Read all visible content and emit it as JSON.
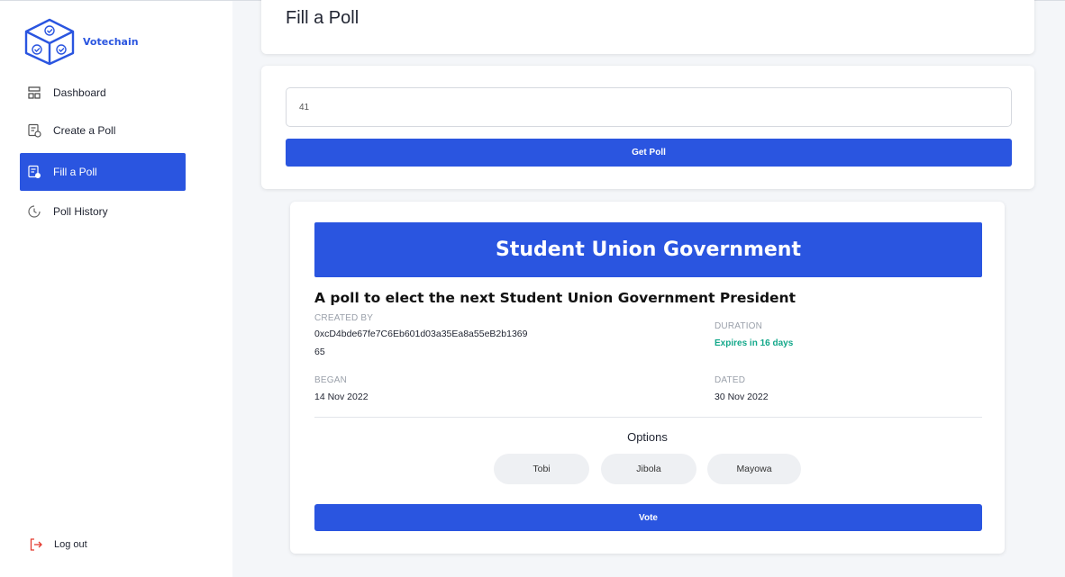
{
  "brand": {
    "name": "Votechain",
    "accent": "#2a55e0"
  },
  "sidebar": {
    "items": [
      {
        "label": "Dashboard",
        "icon": "dashboard-icon",
        "active": false
      },
      {
        "label": "Create a Poll",
        "icon": "create-poll-icon",
        "active": false
      },
      {
        "label": "Fill a Poll",
        "icon": "fill-poll-icon",
        "active": true
      },
      {
        "label": "Poll History",
        "icon": "clock-icon",
        "active": false
      }
    ],
    "logout_label": "Log out"
  },
  "page": {
    "title": "Fill a Poll"
  },
  "search": {
    "value": "41",
    "button_label": "Get Poll"
  },
  "poll": {
    "title": "Student Union Government",
    "description": "A poll to elect the next Student Union Government President",
    "created_by_label": "CREATED BY",
    "created_by_line1": "0xcD4bde67fe7C6Eb601d03a35Ea8a55eB2b1369",
    "created_by_line2": "65",
    "duration_label": "DURATION",
    "duration_value": "Expires in 16 days",
    "began_label": "BEGAN",
    "began_value": "14 Nov 2022",
    "dated_label": "DATED",
    "dated_value": "30 Nov 2022",
    "options_title": "Options",
    "options": [
      "Tobi",
      "Jibola",
      "Mayowa"
    ],
    "vote_label": "Vote"
  },
  "colors": {
    "accent": "#2a55e0",
    "success": "#13a88a",
    "chip": "#eef0f3"
  }
}
